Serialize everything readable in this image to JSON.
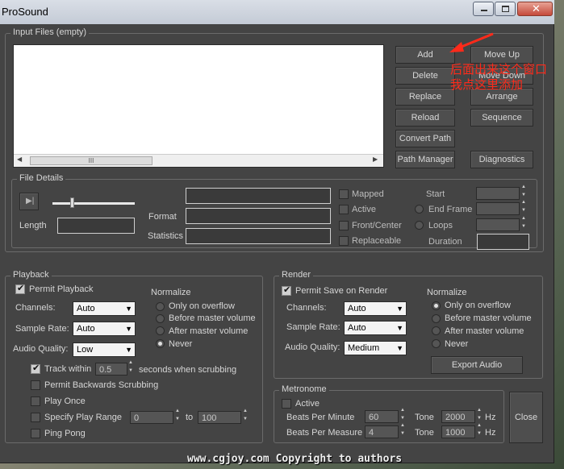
{
  "window": {
    "title": "ProSound"
  },
  "input_files": {
    "group_title": "Input Files (empty)",
    "buttons": {
      "add": "Add",
      "move_up": "Move Up",
      "delete": "Delete",
      "move_down": "Move Down",
      "replace": "Replace",
      "arrange": "Arrange",
      "reload": "Reload",
      "sequence": "Sequence",
      "convert_path": "Convert Path",
      "path_manager": "Path Manager",
      "diagnostics": "Diagnostics"
    },
    "scroll_thumb": "III"
  },
  "annotation": {
    "line1": "后面出来这个窗口",
    "line2": "我点这里添加"
  },
  "file_details": {
    "group_title": "File Details",
    "length": "Length",
    "format": "Format",
    "statistics": "Statistics",
    "mapped": "Mapped",
    "active": "Active",
    "front_center": "Front/Center",
    "replaceable": "Replaceable",
    "start": "Start",
    "end_frame": "End Frame",
    "loops": "Loops",
    "duration": "Duration"
  },
  "playback": {
    "group_title": "Playback",
    "permit_playback": "Permit Playback",
    "channels_label": "Channels:",
    "channels_value": "Auto",
    "sample_rate_label": "Sample Rate:",
    "sample_rate_value": "Auto",
    "audio_quality_label": "Audio Quality:",
    "audio_quality_value": "Low",
    "normalize": "Normalize",
    "norm_options": [
      "Only on overflow",
      "Before master volume",
      "After master volume",
      "Never"
    ],
    "track_within": "Track within",
    "track_value": "0.5",
    "seconds_when": "seconds when scrubbing",
    "permit_backwards": "Permit Backwards Scrubbing",
    "play_once": "Play Once",
    "specify_play_range": "Specify Play Range",
    "range_from": "0",
    "to": "to",
    "range_to": "100",
    "ping_pong": "Ping Pong"
  },
  "render": {
    "group_title": "Render",
    "permit_save": "Permit Save on Render",
    "channels_label": "Channels:",
    "channels_value": "Auto",
    "sample_rate_label": "Sample Rate:",
    "sample_rate_value": "Auto",
    "audio_quality_label": "Audio Quality:",
    "audio_quality_value": "Medium",
    "normalize": "Normalize",
    "norm_options": [
      "Only on overflow",
      "Before master volume",
      "After master volume",
      "Never"
    ],
    "export_audio": "Export Audio"
  },
  "metronome": {
    "group_title": "Metronome",
    "active": "Active",
    "beats_per_minute": "Beats Per Minute",
    "bpm_value": "60",
    "tone": "Tone",
    "tone1_value": "2000",
    "hz": "Hz",
    "beats_per_measure": "Beats Per Measure",
    "bpmeasure_value": "4",
    "tone2_value": "1000"
  },
  "close": "Close",
  "watermark": "www.cgjoy.com Copyright to authors"
}
